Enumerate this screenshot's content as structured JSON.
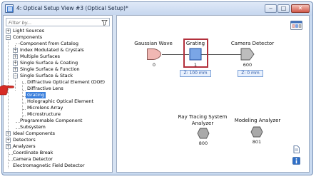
{
  "window": {
    "title": "4: Optical Setup View #3 (Optical Setup)*",
    "controls": [
      "‒",
      "□",
      "✕"
    ]
  },
  "filter": {
    "placeholder": "Filter by..."
  },
  "tree": [
    {
      "label": "Light Sources",
      "toggle": "+"
    },
    {
      "label": "Components",
      "toggle": "−"
    },
    {
      "label": "Component from Catalog"
    },
    {
      "label": "Index Modulated & Crystals",
      "toggle": "+"
    },
    {
      "label": "Multiple Surfaces",
      "toggle": "+"
    },
    {
      "label": "Single Surface & Coating",
      "toggle": "+"
    },
    {
      "label": "Single Surface & Function",
      "toggle": "+"
    },
    {
      "label": "Single Surface & Stack",
      "toggle": "−"
    },
    {
      "label": "Diffractive Optical Element (DOE)"
    },
    {
      "label": "Diffractive Lens"
    },
    {
      "label": "Grating",
      "selected": true
    },
    {
      "label": "Holographic Optical Element"
    },
    {
      "label": "Microlens Array"
    },
    {
      "label": "Microstructure"
    },
    {
      "label": "Programmable Component"
    },
    {
      "label": "Subsystem"
    },
    {
      "label": "Ideal Components",
      "toggle": "+"
    },
    {
      "label": "Detectors",
      "toggle": "+"
    },
    {
      "label": "Analyzers",
      "toggle": "+"
    },
    {
      "label": "Coordinate Break"
    },
    {
      "label": "Camera Detector"
    },
    {
      "label": "Electromagnetic Field Detector"
    }
  ],
  "canvas": {
    "components": [
      {
        "name": "Gaussian Wave",
        "number": "0"
      },
      {
        "name": "Grating",
        "number": "1",
        "distance": "Z: 100 mm",
        "selected": true
      },
      {
        "name": "Camera Detector",
        "number": "600",
        "distance": "Z: 0 mm"
      },
      {
        "name": "Ray Tracing System Analyzer",
        "name_line1": "Ray Tracing System",
        "name_line2": "Analyzer",
        "number": "800"
      },
      {
        "name": "Modeling Analyzer",
        "number": "801"
      }
    ]
  },
  "icons": {
    "filter": "filter-icon",
    "pointer": "pointing-hand-icon",
    "toolbar_top": "optical-setup-icon",
    "side_doc": "document-icon",
    "side_info": "info-icon"
  },
  "colors": {
    "selection_frame": "#b3303c",
    "tree_selection": "#3a7fdc",
    "source_pink": "#f0b7b3",
    "grating_blue": "#7aa6e6",
    "detector_gray": "#a9a9a9"
  }
}
